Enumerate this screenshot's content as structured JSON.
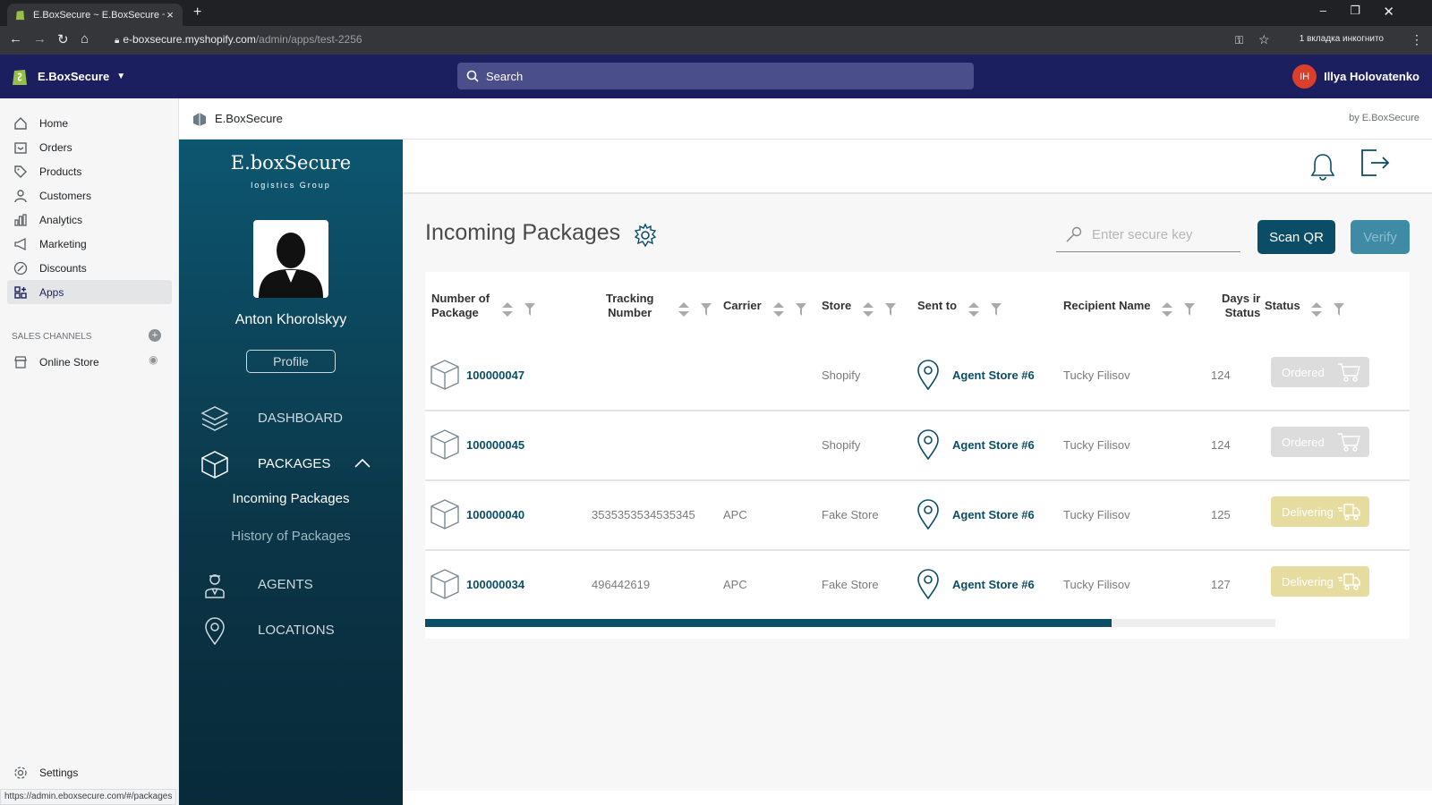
{
  "browser": {
    "tab_title": "E.BoxSecure ~ E.BoxSecure ~ Sh",
    "url_host": "e-boxsecure.myshopify.com",
    "url_path": "/admin/apps/test-2256",
    "incognito_label": "1 вкладка инкогнито",
    "status_url": "https://admin.eboxsecure.com/#/packages"
  },
  "shopify": {
    "store_name": "E.BoxSecure",
    "search_placeholder": "Search",
    "user_initials": "IH",
    "user_name": "Illya Holovatenko",
    "nav": [
      {
        "label": "Home",
        "icon": "home-icon"
      },
      {
        "label": "Orders",
        "icon": "orders-icon"
      },
      {
        "label": "Products",
        "icon": "tag-icon"
      },
      {
        "label": "Customers",
        "icon": "person-icon"
      },
      {
        "label": "Analytics",
        "icon": "bar-chart-icon"
      },
      {
        "label": "Marketing",
        "icon": "megaphone-icon"
      },
      {
        "label": "Discounts",
        "icon": "discount-icon"
      },
      {
        "label": "Apps",
        "icon": "apps-icon"
      }
    ],
    "sales_channels_label": "SALES CHANNELS",
    "online_store": "Online Store",
    "settings": "Settings",
    "app_name": "E.BoxSecure",
    "by_label": "by E.BoxSecure"
  },
  "ebox": {
    "brand": "E.boxSecure",
    "brand_sub": "logistics Group",
    "person_name": "Anton Khorolskyy",
    "profile_label": "Profile",
    "nav": {
      "dashboard": "DASHBOARD",
      "packages": "PACKAGES",
      "incoming": "Incoming Packages",
      "history": "History of Packages",
      "agents": "AGENTS",
      "locations": "LOCATIONS"
    }
  },
  "main": {
    "title": "Incoming Packages",
    "secure_key_placeholder": "Enter secure key",
    "scan_label": "Scan QR",
    "verify_label": "Verify",
    "columns": {
      "number_1": "Number of",
      "number_2": "Package",
      "tracking_1": "Tracking",
      "tracking_2": "Number",
      "carrier": "Carrier",
      "store": "Store",
      "sent_to": "Sent to",
      "recipient": "Recipient Name",
      "days_1": "Days ir",
      "days_2": "Status",
      "status": "Status"
    },
    "rows": [
      {
        "number": "100000047",
        "tracking": "",
        "carrier": "",
        "store": "Shopify",
        "sent_to": "Agent Store #6",
        "recipient": "Tucky Filisov",
        "days": "124",
        "status": "Ordered"
      },
      {
        "number": "100000045",
        "tracking": "",
        "carrier": "",
        "store": "Shopify",
        "sent_to": "Agent Store #6",
        "recipient": "Tucky Filisov",
        "days": "124",
        "status": "Ordered"
      },
      {
        "number": "100000040",
        "tracking": "3535353534535345",
        "carrier": "APC",
        "store": "Fake Store",
        "sent_to": "Agent Store #6",
        "recipient": "Tucky Filisov",
        "days": "125",
        "status": "Delivering"
      },
      {
        "number": "100000034",
        "tracking": "496442619",
        "carrier": "APC",
        "store": "Fake Store",
        "sent_to": "Agent Store #6",
        "recipient": "Tucky Filisov",
        "days": "127",
        "status": "Delivering"
      }
    ],
    "colors": {
      "accent": "#0b4d66",
      "ordered": "#dcdcdc",
      "delivering": "#e6dca0"
    }
  }
}
